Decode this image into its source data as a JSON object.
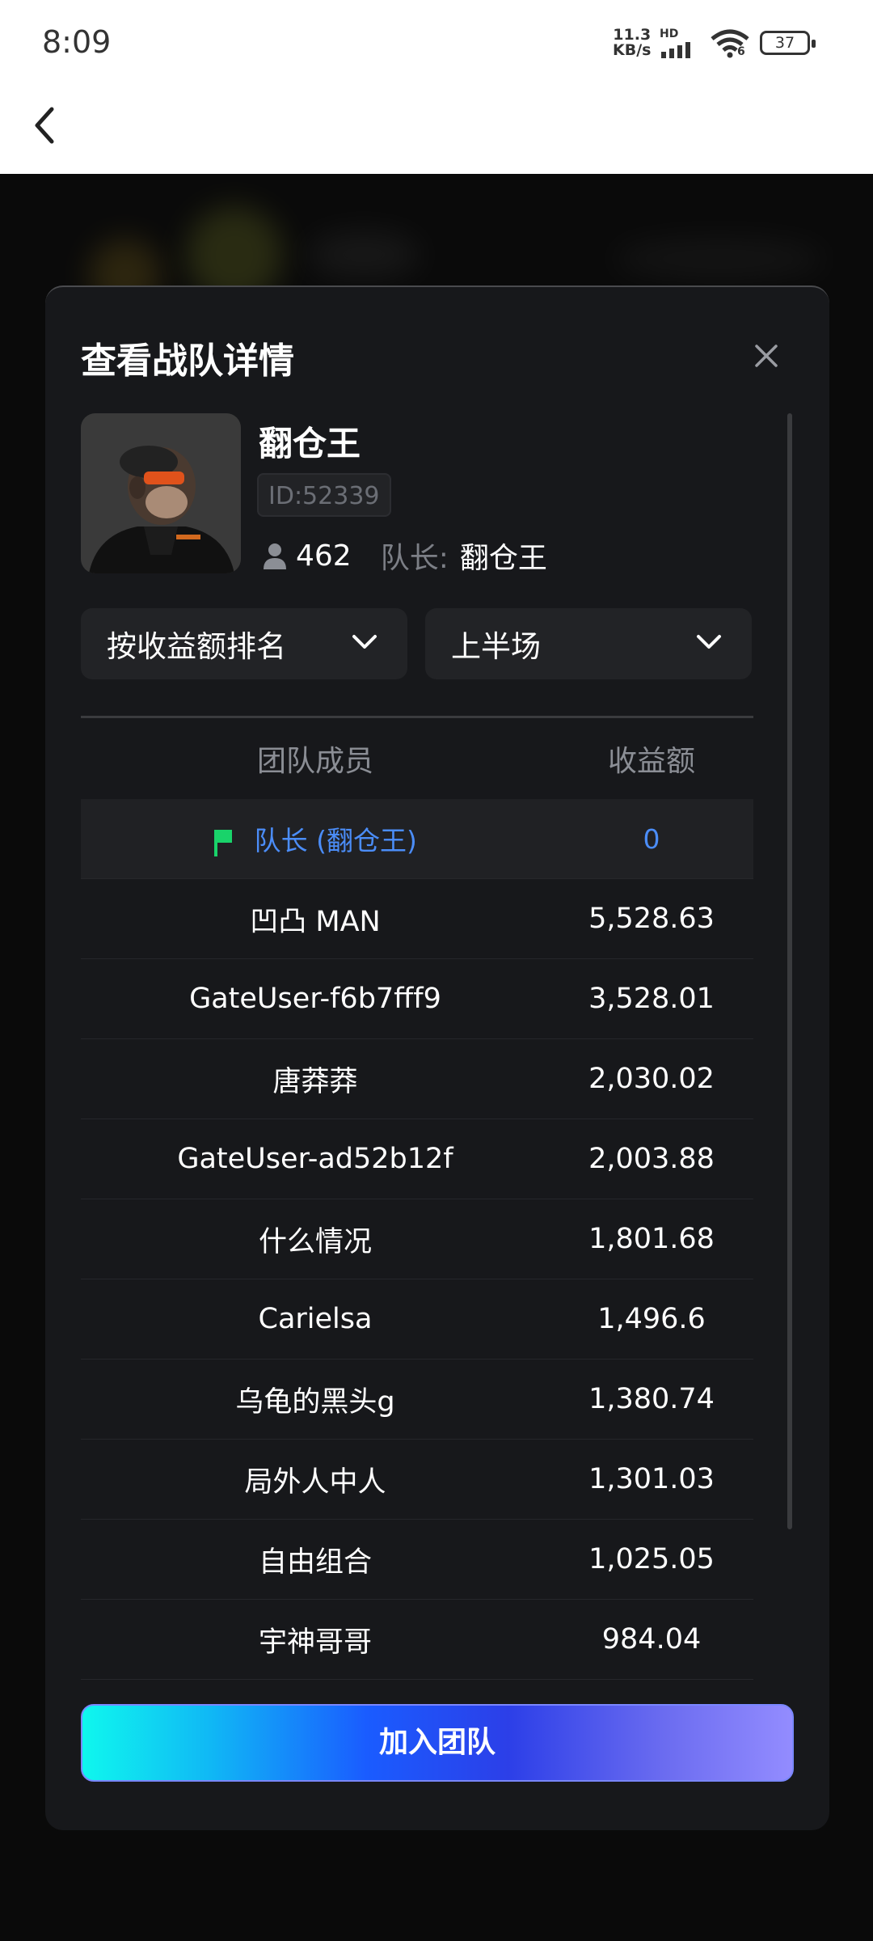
{
  "status_bar": {
    "time": "8:09",
    "net_speed_value": "11.3",
    "net_speed_unit": "KB/s",
    "hd": "HD",
    "wifi_badge": "6",
    "battery": "37"
  },
  "modal": {
    "title": "查看战队详情",
    "team": {
      "name": "翻仓王",
      "id": "ID:52339",
      "member_count": "462",
      "captain_label": "队长:",
      "captain_name": "翻仓王"
    },
    "sort_dropdown": "按收益额排名",
    "period_dropdown": "上半场",
    "table": {
      "headers": [
        "团队成员",
        "收益额"
      ],
      "captain_row": {
        "name": "队长 (翻仓王)",
        "value": "0"
      },
      "rows": [
        {
          "name": "凹凸 MAN",
          "value": "5,528.63"
        },
        {
          "name": "GateUser-f6b7fff9",
          "value": "3,528.01"
        },
        {
          "name": "唐莽莽",
          "value": "2,030.02"
        },
        {
          "name": "GateUser-ad52b12f",
          "value": "2,003.88"
        },
        {
          "name": "什么情况",
          "value": "1,801.68"
        },
        {
          "name": "Carielsa",
          "value": "1,496.6"
        },
        {
          "name": "乌龟的黑头g",
          "value": "1,380.74"
        },
        {
          "name": "局外人中人",
          "value": "1,301.03"
        },
        {
          "name": "自由组合",
          "value": "1,025.05"
        },
        {
          "name": "宇神哥哥",
          "value": "984.04"
        }
      ]
    },
    "join_button": "加入团队"
  },
  "colors": {
    "modal_bg": "#17181b",
    "accent_blue": "#4b8df8",
    "flag_green": "#19d36a"
  }
}
